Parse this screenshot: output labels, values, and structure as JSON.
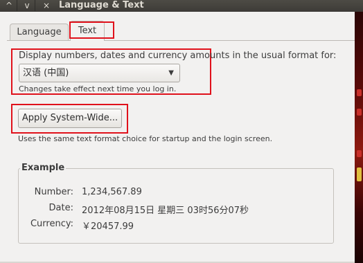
{
  "window": {
    "title": "Language & Text",
    "controls": {
      "up": "^",
      "down": "v",
      "close": "×"
    }
  },
  "tabs": [
    {
      "label": "Language",
      "active": false
    },
    {
      "label": "Text",
      "active": true
    }
  ],
  "format_section": {
    "label": "Display numbers, dates and currency amounts in the usual format for:",
    "selected_locale": "汉语 (中国)",
    "dropdown_arrow": "▼",
    "note": "Changes take effect next time you log in."
  },
  "apply": {
    "button_label": "Apply System-Wide...",
    "note": "Uses the same text format choice for startup and the login screen."
  },
  "example": {
    "title": "Example",
    "number_label": "Number:",
    "number_value": "1,234,567.89",
    "date_label": "Date:",
    "date_value": "2012年08月15日 星期三 03时56分07秒",
    "currency_label": "Currency:",
    "currency_value": "￥20457.99"
  },
  "colors": {
    "highlight": "#e0111b",
    "titlebar": "#3d3b37",
    "window_bg": "#f2f1f0"
  }
}
